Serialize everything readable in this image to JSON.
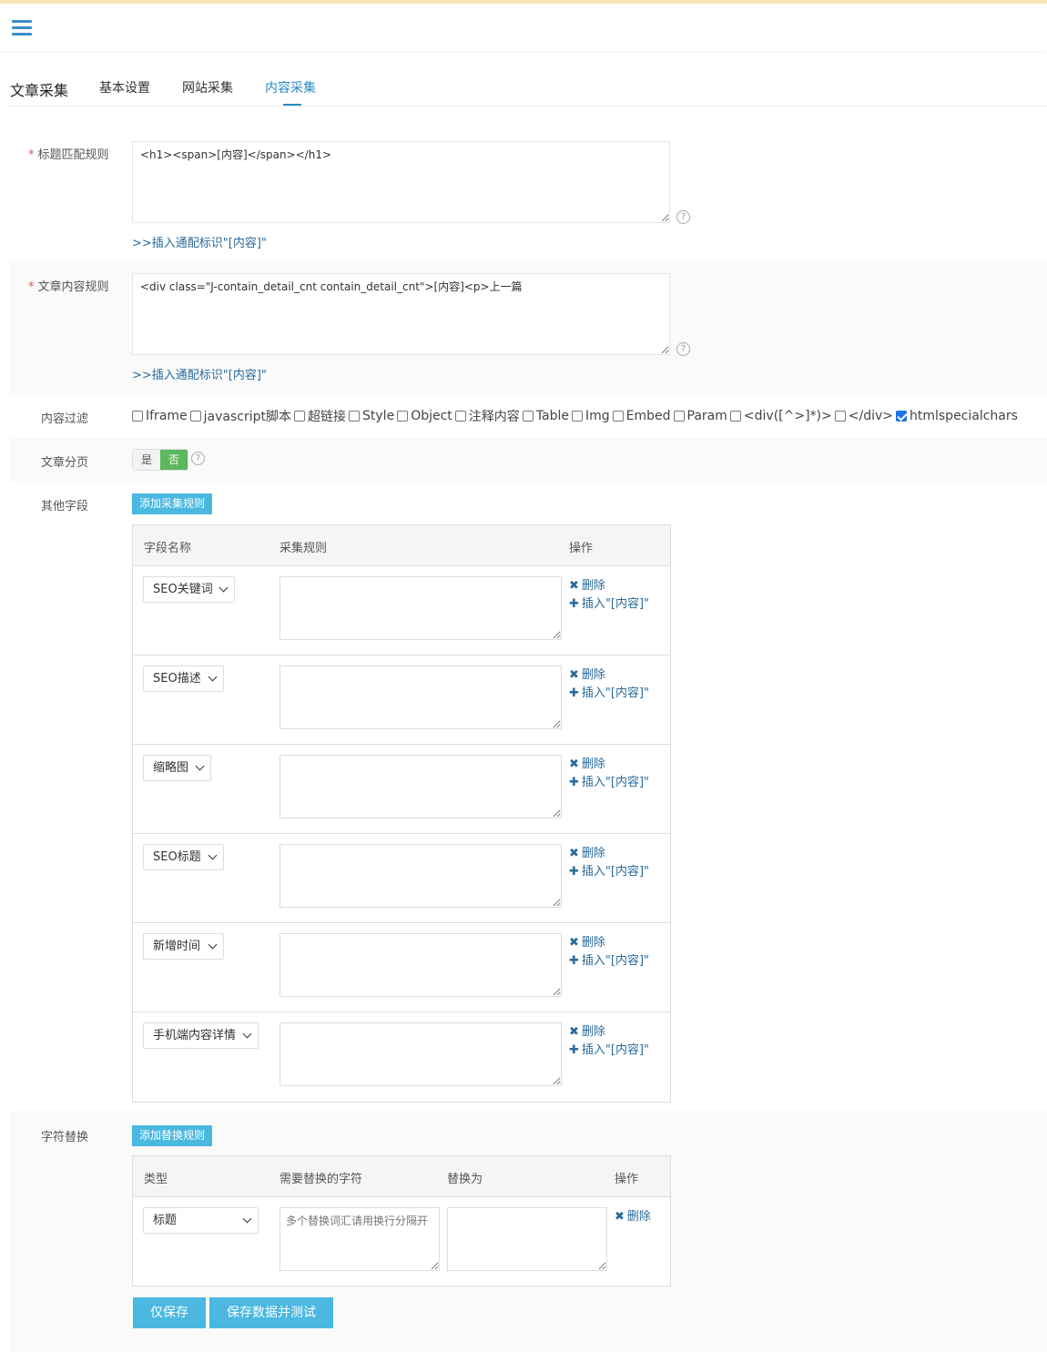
{
  "tabs": {
    "title": "文章采集",
    "items": [
      "基本设置",
      "网站采集",
      "内容采集"
    ]
  },
  "title_rule": {
    "label": "标题匹配规则",
    "value": "<h1><span>[内容]</span></h1>",
    "insert_link": ">>插入通配标识\"[内容]\""
  },
  "content_rule": {
    "label": "文章内容规则",
    "value": "<div class=\"J-contain_detail_cnt contain_detail_cnt\">[内容]<p>上一篇",
    "insert_link": ">>插入通配标识\"[内容]\""
  },
  "filter": {
    "label": "内容过滤",
    "options": [
      {
        "label": "Iframe",
        "checked": false
      },
      {
        "label": "javascript脚本",
        "checked": false
      },
      {
        "label": "超链接",
        "checked": false
      },
      {
        "label": "Style",
        "checked": false
      },
      {
        "label": "Object",
        "checked": false
      },
      {
        "label": "注释内容",
        "checked": false
      },
      {
        "label": "Table",
        "checked": false
      },
      {
        "label": "Img",
        "checked": false
      },
      {
        "label": "Embed",
        "checked": false
      },
      {
        "label": "Param",
        "checked": false
      },
      {
        "label": "<div([^>]*)>",
        "checked": false
      },
      {
        "label": "</div>",
        "checked": false
      },
      {
        "label": "htmlspecialchars",
        "checked": true
      }
    ]
  },
  "paging": {
    "label": "文章分页",
    "yes": "是",
    "no": "否",
    "selected": "否"
  },
  "other_fields": {
    "label": "其他字段",
    "add_button": "添加采集规则",
    "headers": [
      "字段名称",
      "采集规则",
      "操作"
    ],
    "delete_label": "删除",
    "insert_label": "插入\"[内容]\"",
    "rows": [
      "SEO关键词",
      "SEO描述",
      "缩略图",
      "SEO标题",
      "新增时间",
      "手机端内容详情"
    ]
  },
  "replace": {
    "label": "字符替换",
    "add_button": "添加替换规则",
    "headers": [
      "类型",
      "需要替换的字符",
      "替换为",
      "操作"
    ],
    "type_value": "标题",
    "placeholder": "多个替换词汇请用换行分隔开",
    "delete_label": "删除"
  },
  "buttons": {
    "save": "仅保存",
    "save_test": "保存数据并测试"
  }
}
